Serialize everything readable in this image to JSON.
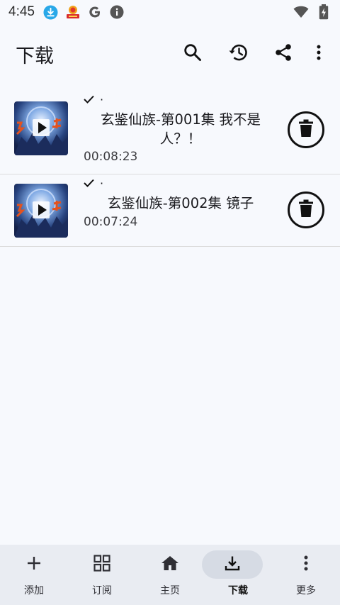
{
  "status_bar": {
    "time": "4:45",
    "icons": [
      "download-notification-icon",
      "app-notification-icon",
      "google-icon",
      "info-icon",
      "wifi-icon",
      "battery-charging-icon"
    ]
  },
  "app_bar": {
    "title": "下载",
    "actions": [
      "search-icon",
      "history-icon",
      "share-icon",
      "more-vert-icon"
    ]
  },
  "downloads": [
    {
      "status": "·",
      "title": "玄鉴仙族-第001集 我不是人？！",
      "duration": "00:08:23",
      "thumbnail_text": "玄鉴仙族"
    },
    {
      "status": "·",
      "title": "玄鉴仙族-第002集 镜子",
      "duration": "00:07:24",
      "thumbnail_text": "玄鉴仙族"
    }
  ],
  "bottom_nav": {
    "items": [
      {
        "label": "添加",
        "icon": "plus-icon"
      },
      {
        "label": "订阅",
        "icon": "grid-icon"
      },
      {
        "label": "主页",
        "icon": "home-icon"
      },
      {
        "label": "下载",
        "icon": "download-icon"
      },
      {
        "label": "更多",
        "icon": "more-vert-icon"
      }
    ],
    "active": "下载"
  }
}
